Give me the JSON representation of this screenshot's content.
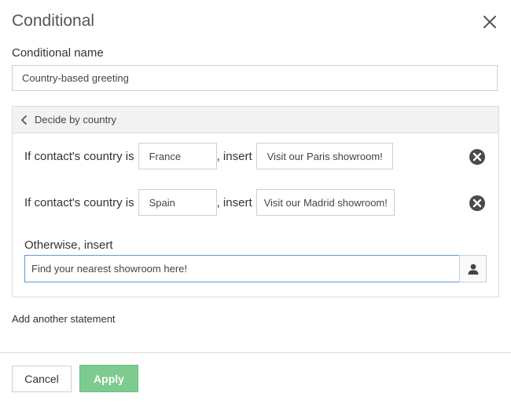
{
  "dialog": {
    "title": "Conditional"
  },
  "name_field": {
    "label": "Conditional name",
    "value": "Country-based greeting"
  },
  "panel": {
    "header": "Decide by country",
    "statements": [
      {
        "prefix": "If contact's country is",
        "country": "France",
        "middle": ", insert",
        "insert_value": "Visit our Paris showroom!"
      },
      {
        "prefix": "If contact's country is",
        "country": "Spain",
        "middle": ", insert",
        "insert_value": "Visit our Madrid showroom!"
      }
    ],
    "otherwise": {
      "label": "Otherwise, insert",
      "value": "Find your nearest showroom here!"
    }
  },
  "add_statement_label": "Add another statement",
  "footer": {
    "cancel_label": "Cancel",
    "apply_label": "Apply"
  },
  "colors": {
    "apply_bg": "#7dcb8e",
    "focus_border": "#5b9bd5",
    "remove_icon": "#4a4a4a"
  },
  "icons": {
    "close": "close-icon",
    "back": "chevron-left-icon",
    "remove": "remove-circle-icon",
    "person": "person-icon"
  }
}
